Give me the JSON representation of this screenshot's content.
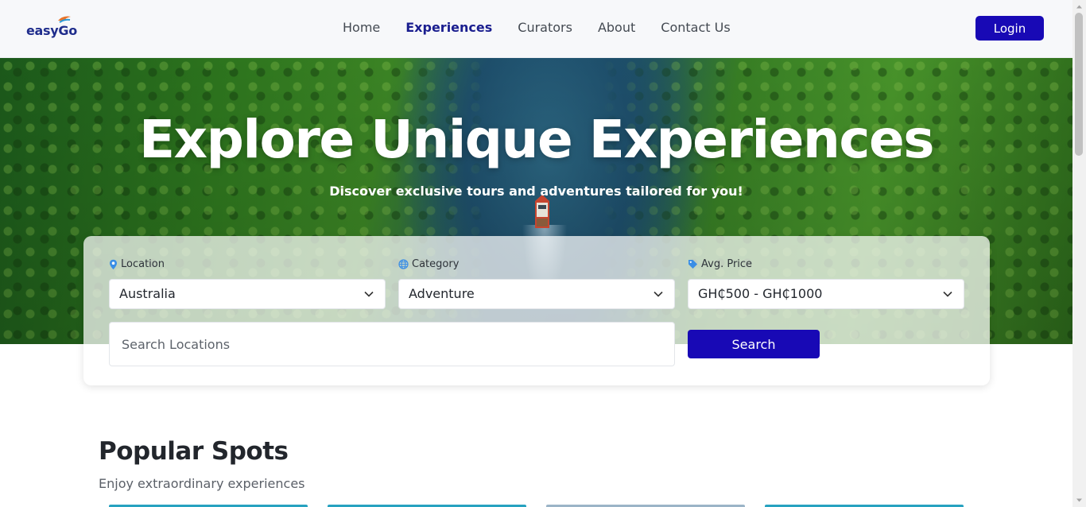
{
  "header": {
    "logo_text": "easyGo",
    "nav": [
      {
        "label": "Home",
        "active": false
      },
      {
        "label": "Experiences",
        "active": true
      },
      {
        "label": "Curators",
        "active": false
      },
      {
        "label": "About",
        "active": false
      },
      {
        "label": "Contact Us",
        "active": false
      }
    ],
    "login_label": "Login"
  },
  "hero": {
    "title": "Explore Unique Experiences",
    "subtitle": "Discover exclusive tours and adventures tailored for you!"
  },
  "search": {
    "location": {
      "label": "Location",
      "value": "Australia",
      "icon": "map-pin-icon"
    },
    "category": {
      "label": "Category",
      "value": "Adventure",
      "icon": "globe-icon"
    },
    "price": {
      "label": "Avg. Price",
      "value": "GH₵500 - GH₵1000",
      "icon": "price-tag-icon"
    },
    "input_placeholder": "Search Locations",
    "button_label": "Search"
  },
  "popular": {
    "title": "Popular Spots",
    "subtitle": "Enjoy extraordinary experiences"
  },
  "colors": {
    "accent": "#1809b5",
    "nav_active": "#1a1e8f",
    "header_bg": "#f7f8fa"
  }
}
